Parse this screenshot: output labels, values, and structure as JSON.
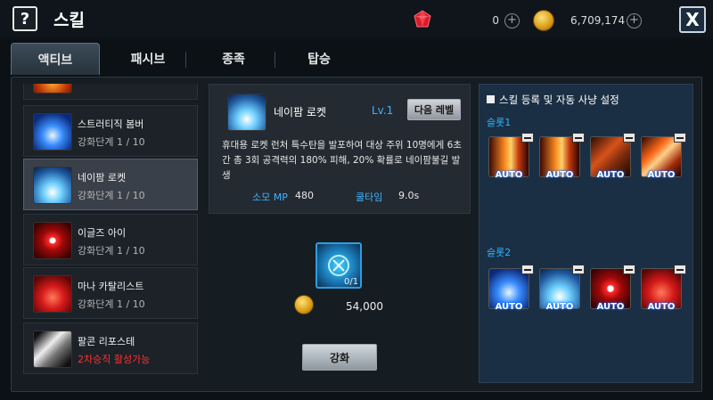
{
  "header": {
    "help_label": "?",
    "title": "스킬",
    "gem_icon": "red-gem-icon",
    "gem_count": "0",
    "gem_plus": "+",
    "gold_icon": "gold-coin-icon",
    "gold_count": "6,709,174",
    "gold_plus": "+",
    "close_label": "X"
  },
  "tabs": [
    {
      "label": "액티브",
      "active": true
    },
    {
      "label": "패시브",
      "active": false
    },
    {
      "label": "종족",
      "active": false
    },
    {
      "label": "탑승",
      "active": false
    }
  ],
  "skills": [
    {
      "name": "스트러티직 봄버",
      "level": "강화단계 1 / 10",
      "icon": "blue-blast-icon"
    },
    {
      "name": "네이팜 로켓",
      "level": "강화단계 1 / 10",
      "icon": "napalm-rocket-icon",
      "selected": true
    },
    {
      "name": "이글즈 아이",
      "level": "강화단계 1 / 10",
      "icon": "eagle-eye-icon"
    },
    {
      "name": "마나 카탈리스트",
      "level": "강화단계 1 / 10",
      "icon": "mana-catalyst-icon"
    },
    {
      "name": "팔콘 리포스테",
      "level": "2차승직 활성가능",
      "icon": "falcon-riposte-icon",
      "level_red": true
    }
  ],
  "detail": {
    "name": "네이팜 로켓",
    "level": "Lv.1",
    "next_level_button": "다음 레벨",
    "description": "휴대용 로켓 런처 특수탄을 발포하여 대상 주위 10명에게 6초간 총 3회 공격력의 180% 피해, 20% 확률로 네이팜불길 발생",
    "mp_label": "소모 MP",
    "mp_value": "480",
    "cooldown_label": "쿨타임",
    "cooldown_value": "9.0s"
  },
  "upgrade": {
    "material_icon": "upgrade-rune-icon",
    "material_count": "0/1",
    "cost": "54,000",
    "button_label": "강화"
  },
  "slots": {
    "header": "스킬 등록 및 자동 사냥 설정",
    "group1_label": "슬롯1",
    "group2_label": "슬롯2",
    "auto_label": "AUTO",
    "group1_icons": [
      "fire-gun-icon",
      "fire-gun-icon",
      "rocket-launcher-icon",
      "fire-shell-icon"
    ],
    "group2_icons": [
      "blue-blast-icon",
      "napalm-rocket-icon",
      "eagle-eye-icon",
      "mana-catalyst-icon"
    ]
  },
  "colors": {
    "accent_blue": "#3fb2ff",
    "warning_red": "#ff3030",
    "slot_panel_bg": "#1b2f44"
  }
}
